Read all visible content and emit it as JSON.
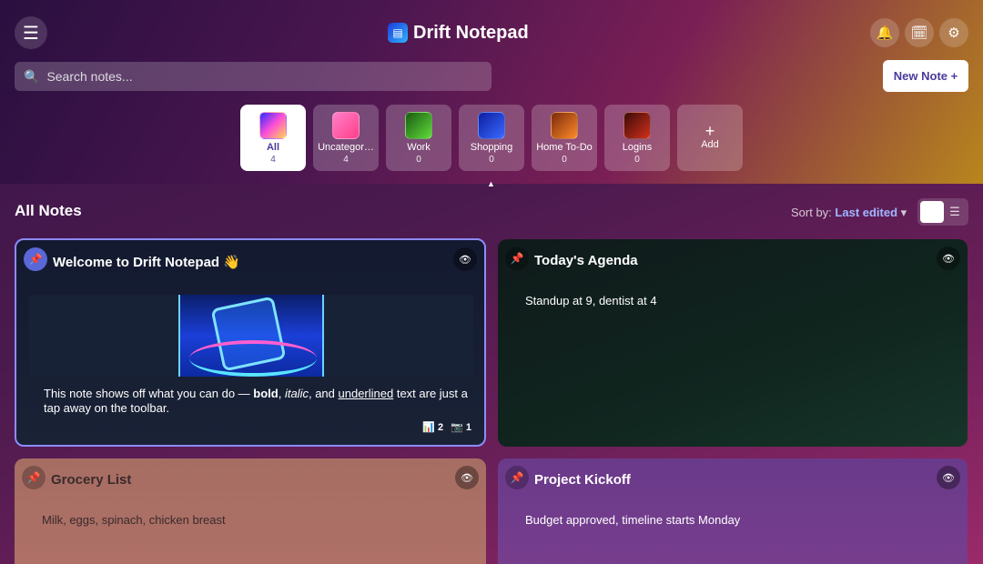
{
  "app": {
    "title": "Drift Notepad",
    "logo_icon": "notepad-logo-icon"
  },
  "header": {
    "menu_icon": "☰",
    "icons": [
      "🔔",
      "🗓",
      "⚙"
    ]
  },
  "search": {
    "placeholder": "Search notes...",
    "value": ""
  },
  "new_note": {
    "label": "New Note +"
  },
  "categories": [
    {
      "name": "All",
      "count": "4",
      "active": true,
      "color": "#7a5cff"
    },
    {
      "name": "Uncategor…",
      "count": "4",
      "color": "#ff5fa8"
    },
    {
      "name": "Work",
      "count": "0",
      "color": "#3aa832"
    },
    {
      "name": "Shopping",
      "count": "0",
      "color": "#1d3bd8"
    },
    {
      "name": "Home To-Do",
      "count": "0",
      "color": "#e06a1a"
    },
    {
      "name": "Logins",
      "count": "0",
      "color": "#a3201a"
    }
  ],
  "add_category": {
    "plus": "+",
    "label": "Add"
  },
  "collapse_icon": "▲",
  "section": {
    "title": "All Notes"
  },
  "sort": {
    "label": "Sort by:",
    "value": "Last edited",
    "caret": "▾"
  },
  "view_toggle": {
    "list_icon": "☰"
  },
  "notes": [
    {
      "title": "Welcome to Drift Notepad 👋",
      "pinned": true,
      "text_start": "This note shows off what you can do — ",
      "bold": "bold",
      "sep1": ", ",
      "italic": "italic",
      "sep2": ", and ",
      "underlined": "underlined",
      "text_end": " text are just a tap away on the toolbar.",
      "meta_charts": "📊 2",
      "meta_photos": "📷 1"
    },
    {
      "title": "Today's Agenda",
      "pinned": false,
      "text": "Standup at 9, dentist at 4"
    },
    {
      "title": "Grocery List",
      "pinned": false,
      "text": "Milk, eggs, spinach, chicken breast"
    },
    {
      "title": "Project Kickoff",
      "pinned": false,
      "text": "Budget approved, timeline starts Monday"
    }
  ],
  "icons": {
    "pin": "📌",
    "eye": "👁"
  }
}
